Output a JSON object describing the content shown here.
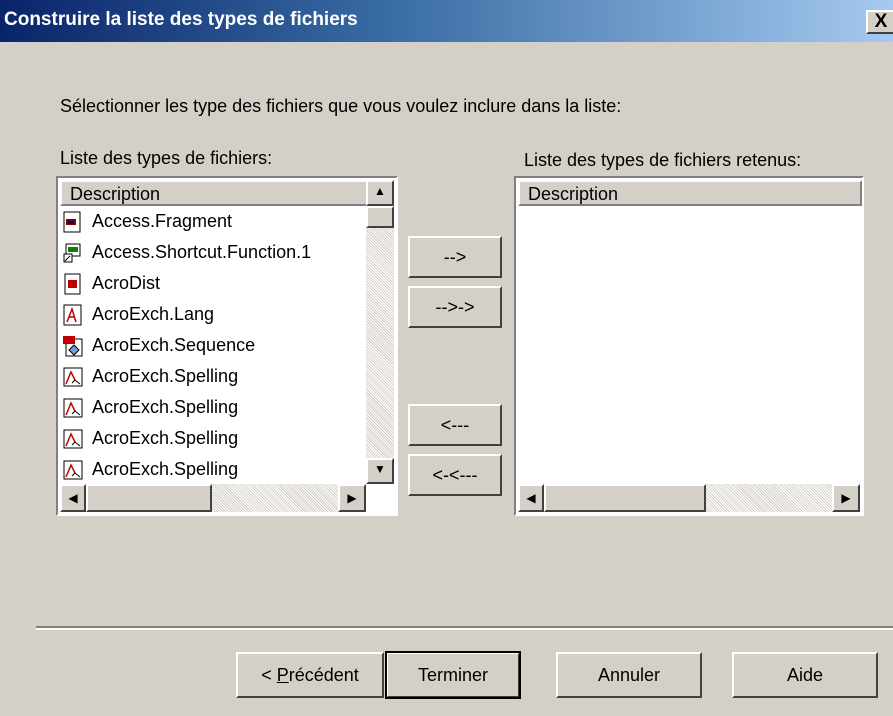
{
  "window": {
    "title": "Construire la liste des types de fichiers",
    "close_glyph": "X"
  },
  "instruction": "Sélectionner les type des fichiers que vous voulez inclure dans la liste:",
  "left_list": {
    "label": "Liste des types de fichiers:",
    "column_header": "Description",
    "items": [
      {
        "label": "Access.Fragment",
        "icon": "access-fragment-icon"
      },
      {
        "label": "Access.Shortcut.Function.1",
        "icon": "access-shortcut-icon"
      },
      {
        "label": "AcroDist",
        "icon": "acrodist-icon"
      },
      {
        "label": "AcroExch.Lang",
        "icon": "acroexch-lang-icon"
      },
      {
        "label": "AcroExch.Sequence",
        "icon": "acroexch-sequence-icon"
      },
      {
        "label": "AcroExch.Spelling",
        "icon": "acroexch-spelling-icon"
      },
      {
        "label": "AcroExch.Spelling",
        "icon": "acroexch-spelling-icon"
      },
      {
        "label": "AcroExch.Spelling",
        "icon": "acroexch-spelling-icon"
      },
      {
        "label": "AcroExch.Spelling",
        "icon": "acroexch-spelling-icon"
      }
    ]
  },
  "right_list": {
    "label": "Liste des types de fichiers retenus:",
    "column_header": "Description"
  },
  "transfer_buttons": {
    "add": "-->",
    "add_all": "-->->",
    "remove": "<---",
    "remove_all": "<-<---"
  },
  "scroll_glyphs": {
    "up": "▲",
    "down": "▼",
    "left": "◀",
    "right": "▶"
  },
  "footer": {
    "prev": "< Précédent",
    "finish": "Terminer",
    "cancel": "Annuler",
    "help": "Aide"
  }
}
